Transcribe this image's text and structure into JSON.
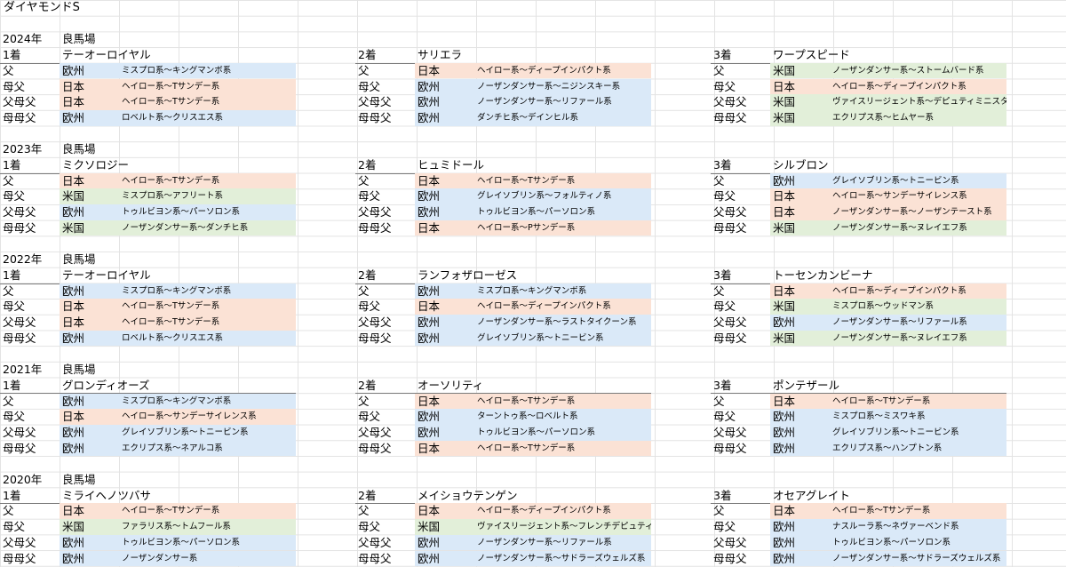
{
  "sheet_title": "ダイヤモンドS",
  "region_colors": {
    "日本": "#fbe2d5",
    "欧州": "#dae9f8",
    "米国": "#e2efd9"
  },
  "years": [
    {
      "year": "2024年",
      "track": "良馬場",
      "placings": [
        {
          "rank": "1着",
          "horse": "テーオーロイヤル",
          "pedigree": [
            {
              "label": "父",
              "region": "欧州",
              "line": "ミスプロ系～キングマンボ系"
            },
            {
              "label": "母父",
              "region": "日本",
              "line": "ヘイロー系～Tサンデー系"
            },
            {
              "label": "父母父",
              "region": "日本",
              "line": "ヘイロー系～Tサンデー系"
            },
            {
              "label": "母母父",
              "region": "欧州",
              "line": "ロベルト系～クリスエス系"
            }
          ]
        },
        {
          "rank": "2着",
          "horse": "サリエラ",
          "pedigree": [
            {
              "label": "父",
              "region": "日本",
              "line": "ヘイロー系～ディープインパクト系"
            },
            {
              "label": "母父",
              "region": "欧州",
              "line": "ノーザンダンサー系～ニジンスキー系"
            },
            {
              "label": "父母父",
              "region": "欧州",
              "line": "ノーザンダンサー系～リファール系"
            },
            {
              "label": "母母父",
              "region": "欧州",
              "line": "ダンチヒ系～デインヒル系"
            }
          ]
        },
        {
          "rank": "3着",
          "horse": "ワープスピード",
          "pedigree": [
            {
              "label": "父",
              "region": "米国",
              "line": "ノーザンダンサー系～ストームバード系"
            },
            {
              "label": "母父",
              "region": "日本",
              "line": "ヘイロー系～ディープインパクト系"
            },
            {
              "label": "父母父",
              "region": "米国",
              "line": "ヴァイスリージェント系～デピュティミニスター系"
            },
            {
              "label": "母母父",
              "region": "米国",
              "line": "エクリプス系～ヒムヤー系"
            }
          ]
        }
      ]
    },
    {
      "year": "2023年",
      "track": "良馬場",
      "placings": [
        {
          "rank": "1着",
          "horse": "ミクソロジー",
          "pedigree": [
            {
              "label": "父",
              "region": "日本",
              "line": "ヘイロー系～Tサンデー系"
            },
            {
              "label": "母父",
              "region": "米国",
              "line": "ミスプロ系～アフリート系"
            },
            {
              "label": "父母父",
              "region": "欧州",
              "line": "トゥルビヨン系～パーソロン系"
            },
            {
              "label": "母母父",
              "region": "米国",
              "line": "ノーザンダンサー系～ダンチヒ系"
            }
          ]
        },
        {
          "rank": "2着",
          "horse": "ヒュミドール",
          "pedigree": [
            {
              "label": "父",
              "region": "日本",
              "line": "ヘイロー系～Tサンデー系"
            },
            {
              "label": "母父",
              "region": "欧州",
              "line": "グレイソブリン系～フォルティノ系"
            },
            {
              "label": "父母父",
              "region": "欧州",
              "line": "トゥルビヨン系～パーソロン系"
            },
            {
              "label": "母母父",
              "region": "日本",
              "line": "ヘイロー系～Pサンデー系"
            }
          ]
        },
        {
          "rank": "3着",
          "horse": "シルブロン",
          "pedigree": [
            {
              "label": "父",
              "region": "欧州",
              "line": "グレイソブリン系～トニービン系"
            },
            {
              "label": "母父",
              "region": "日本",
              "line": "ヘイロー系～サンデーサイレンス系"
            },
            {
              "label": "父母父",
              "region": "日本",
              "line": "ノーザンダンサー系～ノーザンテースト系"
            },
            {
              "label": "母母父",
              "region": "米国",
              "line": "ノーザンダンサー系～ヌレイエフ系"
            }
          ]
        }
      ]
    },
    {
      "year": "2022年",
      "track": "良馬場",
      "placings": [
        {
          "rank": "1着",
          "horse": "テーオーロイヤル",
          "pedigree": [
            {
              "label": "父",
              "region": "欧州",
              "line": "ミスプロ系～キングマンボ系"
            },
            {
              "label": "母父",
              "region": "日本",
              "line": "ヘイロー系～Tサンデー系"
            },
            {
              "label": "父母父",
              "region": "日本",
              "line": "ヘイロー系～Tサンデー系"
            },
            {
              "label": "母母父",
              "region": "欧州",
              "line": "ロベルト系～クリスエス系"
            }
          ]
        },
        {
          "rank": "2着",
          "horse": "ランフォザローゼス",
          "pedigree": [
            {
              "label": "父",
              "region": "欧州",
              "line": "ミスプロ系～キングマンボ系"
            },
            {
              "label": "母父",
              "region": "日本",
              "line": "ヘイロー系～ディープインパクト系"
            },
            {
              "label": "父母父",
              "region": "欧州",
              "line": "ノーザンダンサー系～ラストタイクーン系"
            },
            {
              "label": "母母父",
              "region": "欧州",
              "line": "グレイソブリン系～トニービン系"
            }
          ]
        },
        {
          "rank": "3着",
          "horse": "トーセンカンビーナ",
          "pedigree": [
            {
              "label": "父",
              "region": "日本",
              "line": "ヘイロー系～ディープインパクト系"
            },
            {
              "label": "母父",
              "region": "米国",
              "line": "ミスプロ系～ウッドマン系"
            },
            {
              "label": "父母父",
              "region": "欧州",
              "line": "ノーザンダンサー系～リファール系"
            },
            {
              "label": "母母父",
              "region": "米国",
              "line": "ノーザンダンサー系～ヌレイエフ系"
            }
          ]
        }
      ]
    },
    {
      "year": "2021年",
      "track": "良馬場",
      "placings": [
        {
          "rank": "1着",
          "horse": "グロンディオーズ",
          "pedigree": [
            {
              "label": "父",
              "region": "欧州",
              "line": "ミスプロ系～キングマンボ系"
            },
            {
              "label": "母父",
              "region": "日本",
              "line": "ヘイロー系～サンデーサイレンス系"
            },
            {
              "label": "父母父",
              "region": "欧州",
              "line": "グレイソブリン系～トニービン系"
            },
            {
              "label": "母母父",
              "region": "欧州",
              "line": "エクリプス系～ネアルコ系"
            }
          ]
        },
        {
          "rank": "2着",
          "horse": "オーソリティ",
          "pedigree": [
            {
              "label": "父",
              "region": "日本",
              "line": "ヘイロー系～Tサンデー系"
            },
            {
              "label": "母父",
              "region": "欧州",
              "line": "ターントゥ系～ロベルト系"
            },
            {
              "label": "父母父",
              "region": "欧州",
              "line": "トゥルビヨン系～パーソロン系"
            },
            {
              "label": "母母父",
              "region": "日本",
              "line": "ヘイロー系～Tサンデー系"
            }
          ]
        },
        {
          "rank": "3着",
          "horse": "ポンテザール",
          "pedigree": [
            {
              "label": "父",
              "region": "日本",
              "line": "ヘイロー系～Tサンデー系"
            },
            {
              "label": "母父",
              "region": "欧州",
              "line": "ミスプロ系～ミスワキ系"
            },
            {
              "label": "父母父",
              "region": "欧州",
              "line": "グレイソブリン系～トニービン系"
            },
            {
              "label": "母母父",
              "region": "欧州",
              "line": "エクリプス系～ハンプトン系"
            }
          ]
        }
      ]
    },
    {
      "year": "2020年",
      "track": "良馬場",
      "placings": [
        {
          "rank": "1着",
          "horse": "ミライヘノツバサ",
          "pedigree": [
            {
              "label": "父",
              "region": "日本",
              "line": "ヘイロー系～Tサンデー系"
            },
            {
              "label": "母父",
              "region": "米国",
              "line": "ファラリス系～トムフール系"
            },
            {
              "label": "父母父",
              "region": "欧州",
              "line": "トゥルビヨン系～パーソロン系"
            },
            {
              "label": "母母父",
              "region": "欧州",
              "line": "ノーザンダンサー系"
            }
          ]
        },
        {
          "rank": "2着",
          "horse": "メイショウテンゲン",
          "pedigree": [
            {
              "label": "父",
              "region": "日本",
              "line": "ヘイロー系～ディープインパクト系"
            },
            {
              "label": "母父",
              "region": "米国",
              "line": "ヴァイスリージェント系～フレンチデピュティ系"
            },
            {
              "label": "父母父",
              "region": "欧州",
              "line": "ノーザンダンサー系～リファール系"
            },
            {
              "label": "母母父",
              "region": "欧州",
              "line": "ノーザンダンサー系～サドラーズウェルズ系"
            }
          ]
        },
        {
          "rank": "3着",
          "horse": "オセアグレイト",
          "pedigree": [
            {
              "label": "父",
              "region": "日本",
              "line": "ヘイロー系～Tサンデー系"
            },
            {
              "label": "母父",
              "region": "欧州",
              "line": "ナスルーラ系～ネヴァーベンド系"
            },
            {
              "label": "父母父",
              "region": "欧州",
              "line": "トゥルビヨン系～パーソロン系"
            },
            {
              "label": "母母父",
              "region": "欧州",
              "line": "ノーザンダンサー系～サドラーズウェルズ系"
            }
          ]
        }
      ]
    }
  ]
}
